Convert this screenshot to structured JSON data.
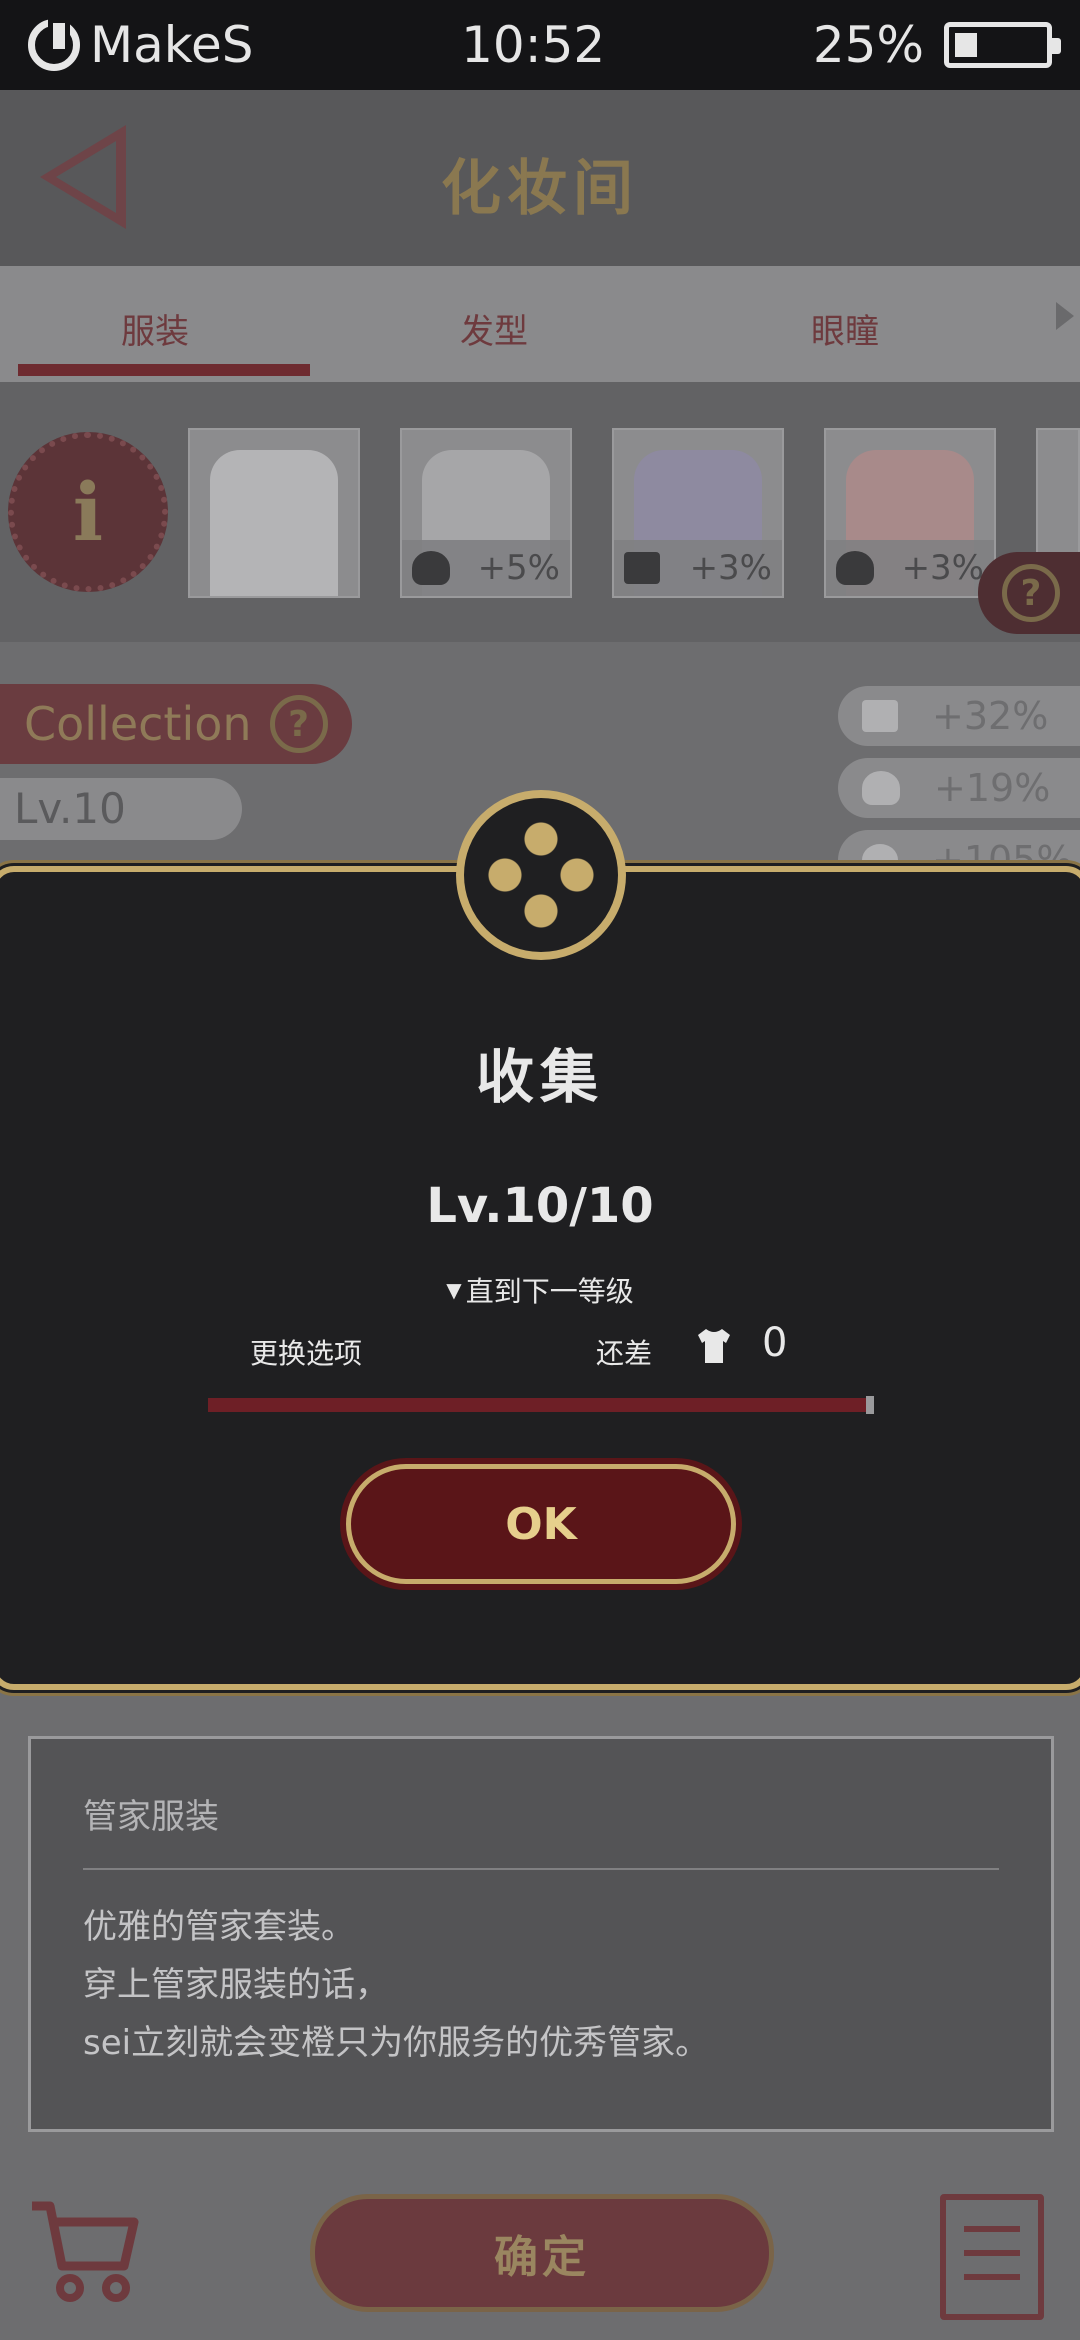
{
  "status_bar": {
    "brand": "MakeS",
    "time": "10:52",
    "battery_percent_label": "25%",
    "battery_level": 0.25
  },
  "header": {
    "title": "化妆间"
  },
  "tabs": [
    {
      "label": "服装",
      "active": true
    },
    {
      "label": "发型",
      "active": false
    },
    {
      "label": "眼瞳",
      "active": false
    }
  ],
  "info_badge": {
    "glyph": "i"
  },
  "outfits": [
    {
      "icon": "",
      "bonus": ""
    },
    {
      "icon": "heart-icon",
      "bonus": "+5%"
    },
    {
      "icon": "card-icon",
      "bonus": "+3%"
    },
    {
      "icon": "heart-icon",
      "bonus": "+3%"
    }
  ],
  "collection": {
    "label": "Collection",
    "help_glyph": "?",
    "level_label": "Lv.10"
  },
  "bonuses": [
    {
      "icon": "card-icon",
      "value": "+32%"
    },
    {
      "icon": "heart-icon",
      "value": "+19%"
    },
    {
      "icon": "info-icon",
      "value": "+105%"
    }
  ],
  "description": {
    "title": "管家服装",
    "lines": [
      "优雅的管家套装。",
      "穿上管家服装的话，",
      "sei立刻就会变橙只为你服务的优秀管家。"
    ]
  },
  "bottom": {
    "confirm_label": "确定"
  },
  "modal": {
    "title": "收集",
    "level": "Lv.10/10",
    "next_level_label": "直到下一等级",
    "swap_option_label": "更换选项",
    "remaining_label": "还差",
    "remaining_count": "0",
    "progress_fraction": 1.0,
    "ok_label": "OK"
  },
  "colors": {
    "gold": "#c7ac6c",
    "maroon": "#5a1518",
    "modal_bg": "#1f1f21"
  }
}
